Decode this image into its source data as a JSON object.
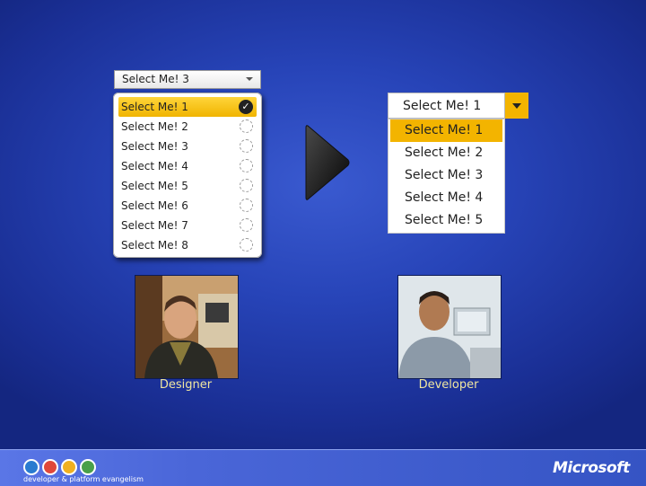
{
  "left_combo": {
    "value": "Select Me! 3",
    "items": [
      "Select Me! 1",
      "Select Me! 2",
      "Select Me! 3",
      "Select Me! 4",
      "Select Me! 5",
      "Select Me! 6",
      "Select Me! 7",
      "Select Me! 8"
    ],
    "checked_index": 0
  },
  "right_combo": {
    "value": "Select Me! 1",
    "items": [
      "Select Me! 1",
      "Select Me! 2",
      "Select Me! 3",
      "Select Me! 4",
      "Select Me! 5"
    ],
    "selected_index": 0
  },
  "people": {
    "designer_label": "Designer",
    "developer_label": "Developer"
  },
  "footer": {
    "tagline": "developer & platform evangelism",
    "brand": "Microsoft"
  },
  "colors": {
    "accent": "#f3b400",
    "background": "#2744b8"
  },
  "icons": [
    "dropdown-arrow-icon",
    "check-icon",
    "radio-icon",
    "big-right-arrow-icon",
    "microsoft-logo"
  ]
}
